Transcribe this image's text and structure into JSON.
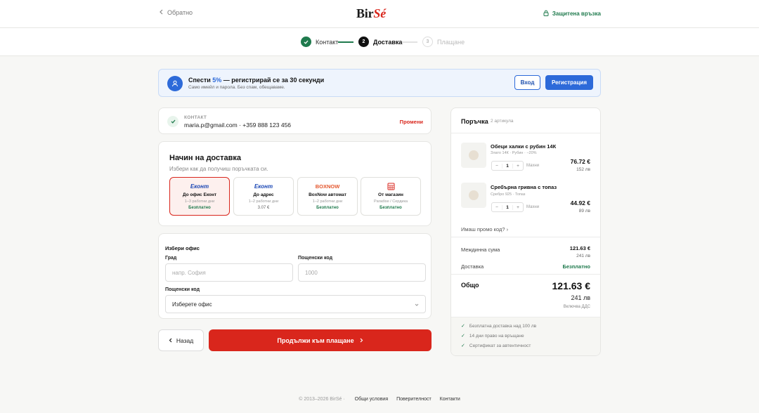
{
  "header": {
    "back_label": "Обратно",
    "logo_main": "Bir",
    "logo_accent": "Sé",
    "secure_label": "Защитена връзка"
  },
  "stepper": {
    "steps": [
      {
        "number": "1",
        "label": "Контакт",
        "state": "done"
      },
      {
        "number": "2",
        "label": "Доставка",
        "state": "current"
      },
      {
        "number": "3",
        "label": "Плащане",
        "state": "upcoming"
      }
    ]
  },
  "promo": {
    "title_prefix": "Спести ",
    "title_pct": "5%",
    "title_suffix": " — регистрирай се за 30 секунди",
    "subtitle": "Само имейл и парола. Без спам, обещаваме.",
    "login_label": "Вход",
    "register_label": "Регистрация"
  },
  "contact": {
    "label": "КОНТАКТ",
    "value": "maria.p@gmail.com · +359 888 123 456",
    "change_label": "Промени"
  },
  "delivery": {
    "title": "Начин на доставка",
    "subtitle": "Избери как да получиш поръчката си.",
    "options": [
      {
        "brand": "Еконт",
        "name": "До офис Еконт",
        "time": "1–3 работни дни",
        "price": "Безплатно",
        "selected": true
      },
      {
        "brand": "Еконт",
        "name": "До адрес",
        "time": "1–2 работни дни",
        "price": "3.07 €",
        "selected": false
      },
      {
        "brand": "BOXNOW",
        "name": "BoxNow автомат",
        "time": "1–2 работни дни",
        "price": "Безплатно",
        "selected": false
      },
      {
        "brand": "",
        "name": "От магазин",
        "time": "Paradise / Сердика",
        "price": "Безплатно",
        "selected": false
      }
    ]
  },
  "office": {
    "title": "Избери офис",
    "city_label": "Град",
    "city_placeholder": "напр. София",
    "zip_label": "Пощенски код",
    "zip_placeholder": "1000",
    "office_label": "Пощенски код",
    "office_value": "Изберете офис"
  },
  "actions": {
    "back_label": "Назад",
    "continue_label": "Продължи към плащане"
  },
  "order": {
    "title": "Поръчка",
    "count": "2 артикула",
    "items": [
      {
        "name": "Обеци халки с рубин 14К",
        "meta": "Злато 14К · Рубин · −20%",
        "qty": "1",
        "remove": "Махни",
        "price_eur": "76.72 €",
        "price_lv": "152 лв"
      },
      {
        "name": "Сребърна гривна с топаз",
        "meta": "Сребро 925 · Топаз",
        "qty": "1",
        "remove": "Махни",
        "price_eur": "44.92 €",
        "price_lv": "89 лв"
      }
    ],
    "promo_link": "Имаш промо код?",
    "subtotal_label": "Междинна сума",
    "subtotal_eur": "121.63 €",
    "subtotal_lv": "241 лв",
    "shipping_label": "Доставка",
    "shipping_value": "Безплатно",
    "total_label": "Общо",
    "total_eur": "121.63 €",
    "total_lv": "241 лв",
    "vat_note": "Включва ДДС",
    "perks": [
      "Безплатна доставка над 100 лв",
      "14 дни право на връщане",
      "Сертификат за автентичност"
    ]
  },
  "footer": {
    "copyright": "© 2013–2026 BirSé ·",
    "links": [
      "Общи условия",
      "Поверителност",
      "Контакти"
    ]
  },
  "colors": {
    "accent": "#d9261c",
    "success": "#1f7a4d",
    "primary": "#2d6ad9"
  }
}
